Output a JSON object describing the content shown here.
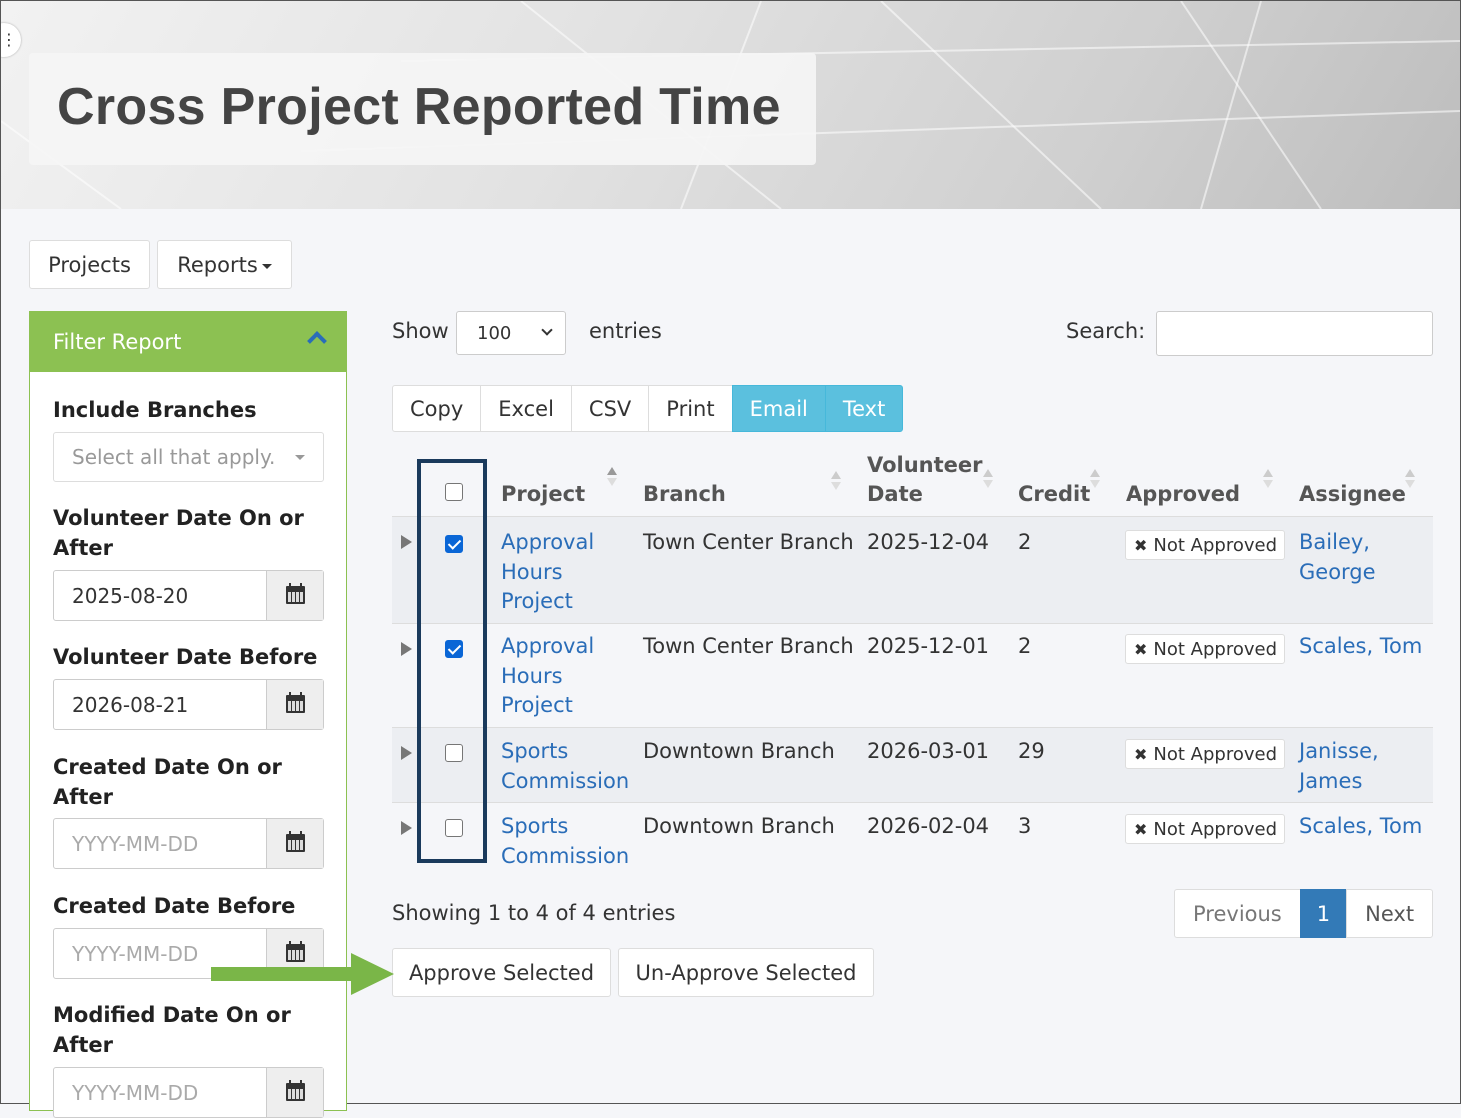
{
  "header": {
    "title": "Cross Project Reported Time"
  },
  "nav": {
    "projects": "Projects",
    "reports": "Reports"
  },
  "filter": {
    "heading": "Filter Report",
    "include_branches_label": "Include Branches",
    "include_branches_placeholder": "Select all that apply.",
    "vol_on_after_label_1": "Volunteer Date On or",
    "vol_on_after_label_2": "After",
    "vol_on_after_value": "2025-08-20",
    "vol_before_label": "Volunteer Date Before",
    "vol_before_value": "2026-08-21",
    "created_on_after_label_1": "Created Date On or",
    "created_on_after_label_2": "After",
    "created_on_after_placeholder": "YYYY-MM-DD",
    "created_before_label": "Created Date Before",
    "created_before_placeholder": "YYYY-MM-DD",
    "modified_on_after_label_1": "Modified Date On or",
    "modified_on_after_label_2": "After",
    "modified_on_after_placeholder": "YYYY-MM-DD"
  },
  "controls": {
    "show": "Show",
    "page_length": "100",
    "entries": "entries",
    "search_label": "Search:",
    "export_buttons": [
      "Copy",
      "Excel",
      "CSV",
      "Print",
      "Email",
      "Text"
    ]
  },
  "table": {
    "headers": {
      "project": "Project",
      "branch": "Branch",
      "volunteer_date_1": "Volunteer",
      "volunteer_date_2": "Date",
      "credit": "Credit",
      "approved": "Approved",
      "assignee": "Assignee"
    },
    "rows": [
      {
        "checked": true,
        "project": [
          "Approval",
          "Hours",
          "Project"
        ],
        "branch": "Town Center Branch",
        "date": "2025-12-04",
        "credit": "2",
        "approved": "Not Approved",
        "assignee": [
          "Bailey,",
          "George"
        ]
      },
      {
        "checked": true,
        "project": [
          "Approval",
          "Hours",
          "Project"
        ],
        "branch": "Town Center Branch",
        "date": "2025-12-01",
        "credit": "2",
        "approved": "Not Approved",
        "assignee": [
          "Scales, Tom"
        ]
      },
      {
        "checked": false,
        "project": [
          "Sports",
          "Commission"
        ],
        "branch": "Downtown Branch",
        "date": "2026-03-01",
        "credit": "29",
        "approved": "Not Approved",
        "assignee": [
          "Janisse,",
          "James"
        ]
      },
      {
        "checked": false,
        "project": [
          "Sports",
          "Commission"
        ],
        "branch": "Downtown Branch",
        "date": "2026-02-04",
        "credit": "3",
        "approved": "Not Approved",
        "assignee": [
          "Scales, Tom"
        ]
      }
    ]
  },
  "footer": {
    "info": "Showing 1 to 4 of 4 entries",
    "previous": "Previous",
    "page": "1",
    "next": "Next",
    "approve_selected": "Approve Selected",
    "unapprove_selected": "Un-Approve Selected"
  },
  "colors": {
    "accent_green": "#8cc152",
    "link_blue": "#2a6db8",
    "info_button": "#5bc0de",
    "pager_active": "#337ab7",
    "highlight_border": "#1a3a5c",
    "annotation_arrow": "#7ab648"
  }
}
